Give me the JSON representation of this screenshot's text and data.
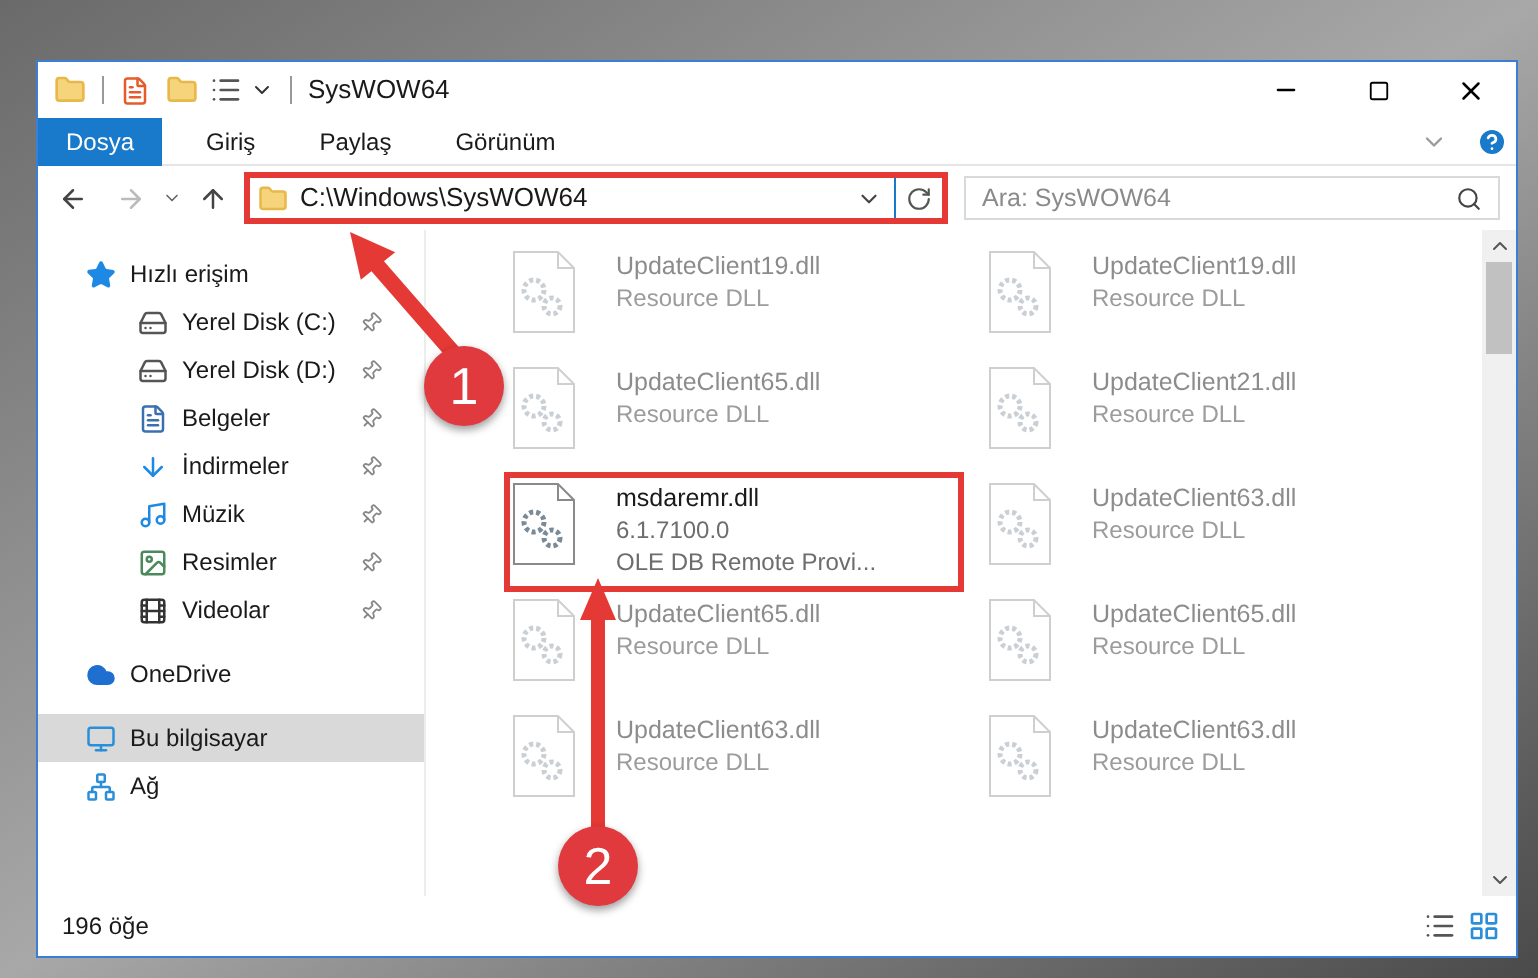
{
  "window": {
    "title": "SysWOW64"
  },
  "ribbon_tabs": [
    {
      "label": "Dosya",
      "kind": "file_menu"
    },
    {
      "label": "Giriş",
      "kind": "tab"
    },
    {
      "label": "Paylaş",
      "kind": "tab"
    },
    {
      "label": "Görünüm",
      "kind": "tab"
    }
  ],
  "address_bar": {
    "path": "C:\\Windows\\SysWOW64",
    "highlighted": true
  },
  "search": {
    "placeholder": "Ara: SysWOW64"
  },
  "sidebar": {
    "items": [
      {
        "label": "Hızlı erişim",
        "kind": "quick",
        "selected": false,
        "children": [
          {
            "label": "Yerel Disk (C:)",
            "kind": "disk_c",
            "pinned": true
          },
          {
            "label": "Yerel Disk (D:)",
            "kind": "disk",
            "pinned": true
          },
          {
            "label": "Belgeler",
            "kind": "docs",
            "pinned": true
          },
          {
            "label": "İndirmeler",
            "kind": "downloads",
            "pinned": true
          },
          {
            "label": "Müzik",
            "kind": "music",
            "pinned": true
          },
          {
            "label": "Resimler",
            "kind": "pictures",
            "pinned": true
          },
          {
            "label": "Videolar",
            "kind": "videos",
            "pinned": true
          }
        ]
      },
      {
        "label": "OneDrive",
        "kind": "cloud",
        "selected": false
      },
      {
        "label": "Bu bilgisayar",
        "kind": "pc",
        "selected": true
      },
      {
        "label": "Ağ",
        "kind": "network",
        "selected": false
      }
    ]
  },
  "files": [
    {
      "name": "UpdateClient19.dll",
      "lines": [
        "Resource DLL"
      ],
      "blurred": true,
      "highlighted": false
    },
    {
      "name": "UpdateClient19.dll",
      "lines": [
        "Resource DLL"
      ],
      "blurred": true,
      "highlighted": false
    },
    {
      "name": "UpdateClient65.dll",
      "lines": [
        "Resource DLL"
      ],
      "blurred": true,
      "highlighted": false
    },
    {
      "name": "UpdateClient21.dll",
      "lines": [
        "Resource DLL"
      ],
      "blurred": true,
      "highlighted": false
    },
    {
      "name": "msdaremr.dll",
      "lines": [
        "6.1.7100.0",
        "OLE DB Remote Provi..."
      ],
      "blurred": false,
      "highlighted": true
    },
    {
      "name": "UpdateClient63.dll",
      "lines": [
        "Resource DLL"
      ],
      "blurred": true,
      "highlighted": false
    },
    {
      "name": "UpdateClient65.dll",
      "lines": [
        "Resource DLL"
      ],
      "blurred": true,
      "highlighted": false
    },
    {
      "name": "UpdateClient65.dll",
      "lines": [
        "Resource DLL"
      ],
      "blurred": true,
      "highlighted": false
    },
    {
      "name": "UpdateClient63.dll",
      "lines": [
        "Resource DLL"
      ],
      "blurred": true,
      "highlighted": false
    },
    {
      "name": "UpdateClient63.dll",
      "lines": [
        "Resource DLL"
      ],
      "blurred": true,
      "highlighted": false
    }
  ],
  "status_bar": {
    "count": "196 öğe"
  },
  "callouts": [
    {
      "number": "1"
    },
    {
      "number": "2"
    }
  ]
}
